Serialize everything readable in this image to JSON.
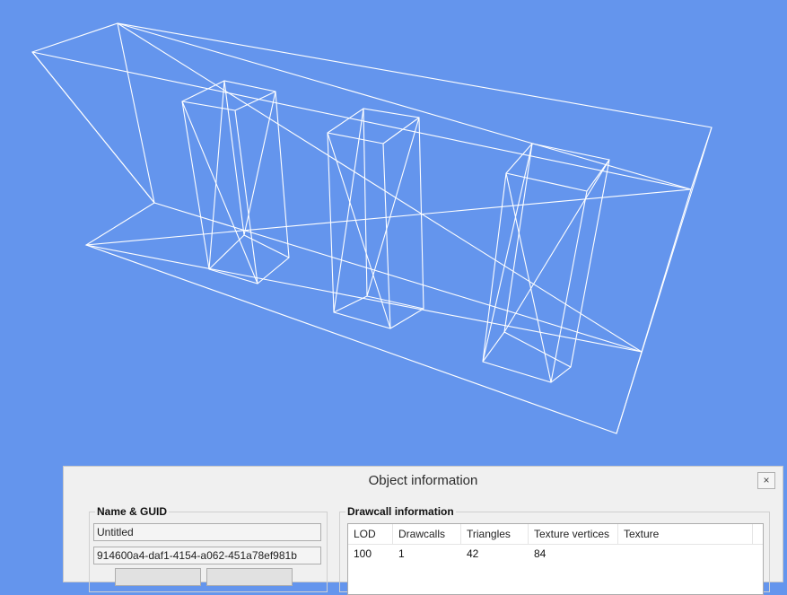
{
  "viewport": {
    "background_color": "#6495ed",
    "wire_color": "#ffffff"
  },
  "dialog": {
    "title": "Object information",
    "close_label": "×",
    "name_guid": {
      "label": "Name & GUID",
      "name_value": "Untitled",
      "guid_value": "914600a4-daf1-4154-a062-451a78ef981b"
    },
    "drawcall": {
      "label": "Drawcall information",
      "columns": [
        "LOD",
        "Drawcalls",
        "Triangles",
        "Texture vertices",
        "Texture"
      ],
      "rows": [
        [
          "100",
          "1",
          "42",
          "84",
          ""
        ]
      ]
    }
  }
}
